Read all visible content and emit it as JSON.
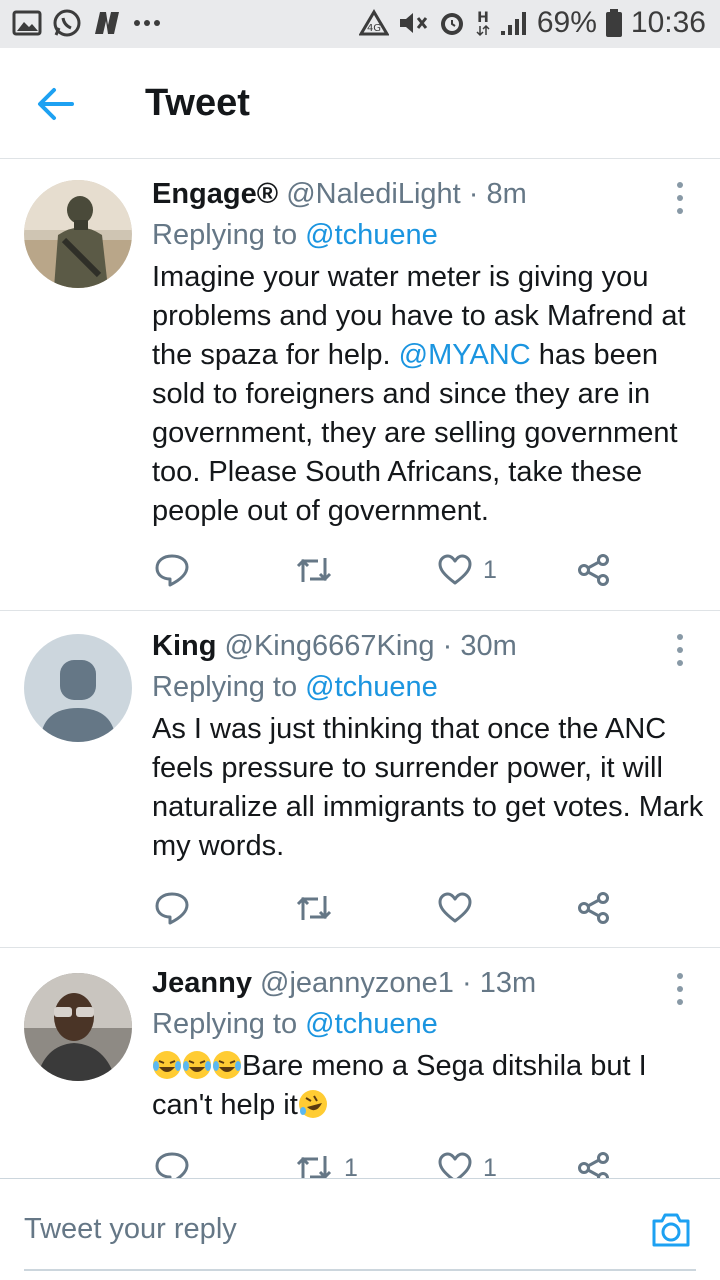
{
  "status_bar": {
    "battery": "69%",
    "time": "10:36",
    "network": "H"
  },
  "header": {
    "title": "Tweet"
  },
  "tweets": [
    {
      "name": "Engage®",
      "handle": "@NalediLight",
      "separator": "·",
      "time": "8m",
      "replying_prefix": "Replying to ",
      "replying_to": "@tchuene",
      "text_1": "Imagine your water meter is giving you problems and you have to ask Mafrend at the spaza for help. ",
      "mention": "@MYANC",
      "text_2": " has been sold to foreigners and since they are in government, they are selling government too. Please South Africans, take these people out of government.",
      "retweets": "",
      "likes": "1"
    },
    {
      "name": "King",
      "handle": "@King6667King",
      "separator": "·",
      "time": "30m",
      "replying_prefix": "Replying to ",
      "replying_to": "@tchuene",
      "text": "As I was just thinking that once the ANC feels pressure to surrender power, it will naturalize all immigrants to get votes. Mark my words.",
      "retweets": "",
      "likes": ""
    },
    {
      "name": "Jeanny",
      "handle": "@jeannyzone1",
      "separator": "·",
      "time": "13m",
      "replying_prefix": "Replying to ",
      "replying_to": "@tchuene",
      "text_1": "Bare meno a Sega ditshila but I can't help it",
      "retweets": "1",
      "likes": "1"
    }
  ],
  "compose": {
    "placeholder": "Tweet your reply"
  },
  "colors": {
    "accent": "#1b95e0",
    "secondary_text": "#657786",
    "divider": "#dfe3e6"
  },
  "icons": [
    "back-arrow-icon",
    "more-vertical-icon",
    "reply-icon",
    "retweet-icon",
    "like-icon",
    "share-icon",
    "camera-icon"
  ]
}
